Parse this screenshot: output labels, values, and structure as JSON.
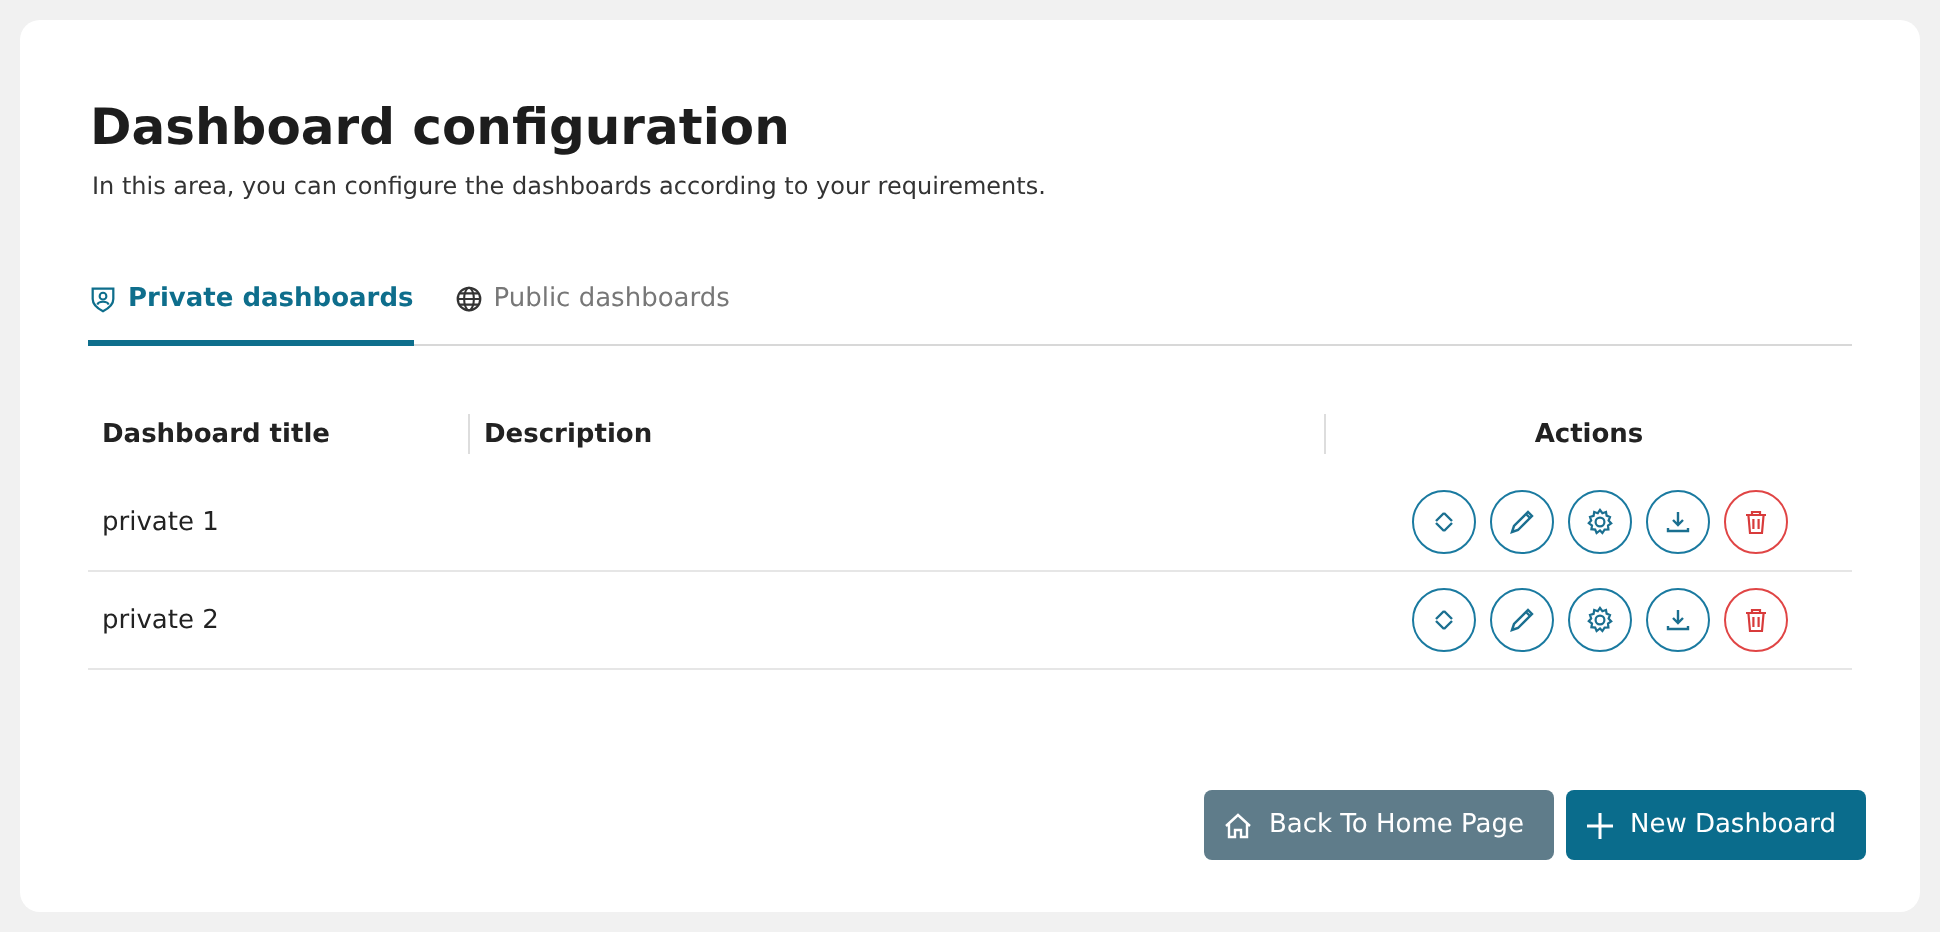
{
  "title": "Dashboard configuration",
  "subtitle": "In this area, you can configure the dashboards according to your requirements.",
  "tabs": [
    {
      "label": "Private dashboards",
      "kind": "private",
      "selected": true
    },
    {
      "label": "Public dashboards",
      "kind": "public",
      "selected": false
    }
  ],
  "table": {
    "columns": [
      "Dashboard title",
      "Description",
      "Actions"
    ],
    "rows": [
      {
        "title": "private 1"
      },
      {
        "title": "private 2"
      }
    ]
  },
  "buttons": [
    {
      "label": "Back To Home Page",
      "kind": "home"
    },
    {
      "label": "New Dashboard",
      "kind": "new"
    }
  ]
}
